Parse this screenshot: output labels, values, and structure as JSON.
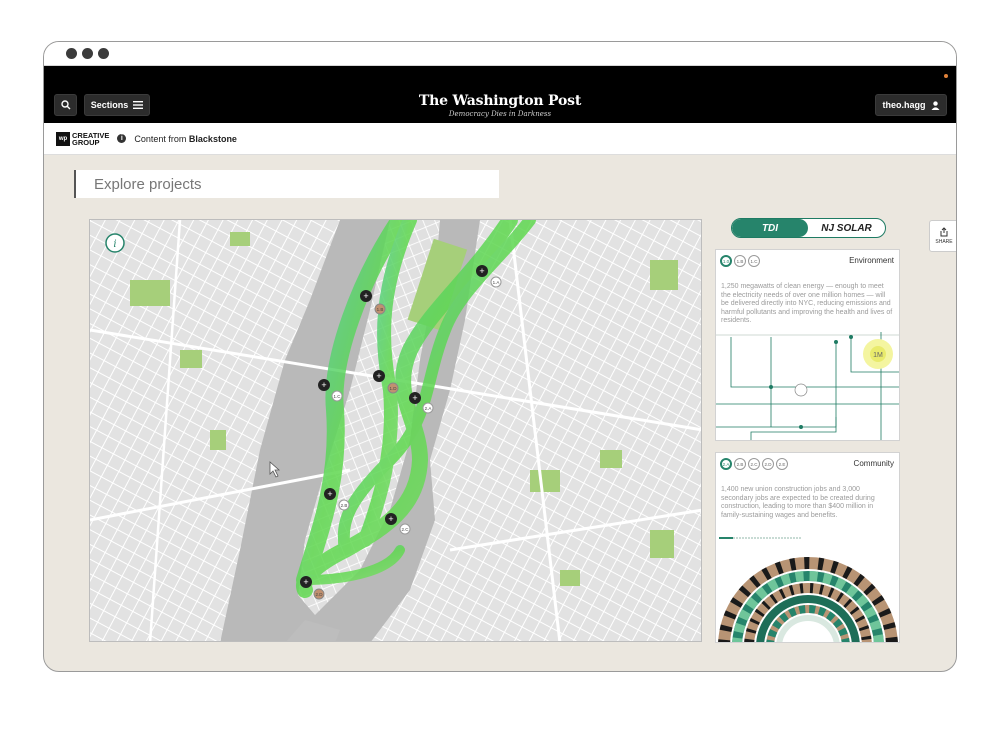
{
  "header": {
    "search_icon": "search-icon",
    "sections_label": "Sections",
    "masthead_title": "The Washington Post",
    "masthead_tagline": "Democracy Dies in Darkness",
    "user_label": "theo.hagg"
  },
  "brand": {
    "logo_box": "wp",
    "logo_line1": "CREATIVE",
    "logo_line2": "GROUP",
    "info_label": "i",
    "content_from_prefix": "Content from",
    "sponsor": "Blackstone"
  },
  "explore": {
    "label": "Explore projects"
  },
  "toggle": {
    "active": "TDI",
    "inactive": "NJ SOLAR"
  },
  "share": {
    "label": "SHARE"
  },
  "environment_card": {
    "title": "Environment",
    "tabs": [
      "1.0",
      "1.B",
      "1.C"
    ],
    "description": "1,250 megawatts of clean energy — enough to meet the electricity needs of over one million homes — will be delivered directly into NYC, reducing emissions and harmful pollutants and improving the health and lives of residents.",
    "highlight": "1M"
  },
  "community_card": {
    "title": "Community",
    "tabs": [
      "2.A",
      "2.B",
      "2.C",
      "2.D",
      "2.E"
    ],
    "description": "1,400 new union construction jobs and 3,000 secondary jobs are expected to be created during construction, leading to more than $400 million in family-sustaining wages and benefits."
  },
  "map": {
    "info_label": "i",
    "markers": [
      {
        "label": "1.A"
      },
      {
        "label": "1.B"
      },
      {
        "label": "1.C"
      },
      {
        "label": "1.D"
      },
      {
        "label": "2.A"
      },
      {
        "label": "2.B"
      },
      {
        "label": "2.C"
      },
      {
        "label": "2.D"
      },
      {
        "label": "3.A"
      },
      {
        "label": "3.B"
      }
    ]
  },
  "colors": {
    "accent": "#26846b",
    "route_green": "#5ed65e",
    "park": "#a6cf7a",
    "water": "#b7b7b7",
    "land": "#e9e9e9"
  }
}
